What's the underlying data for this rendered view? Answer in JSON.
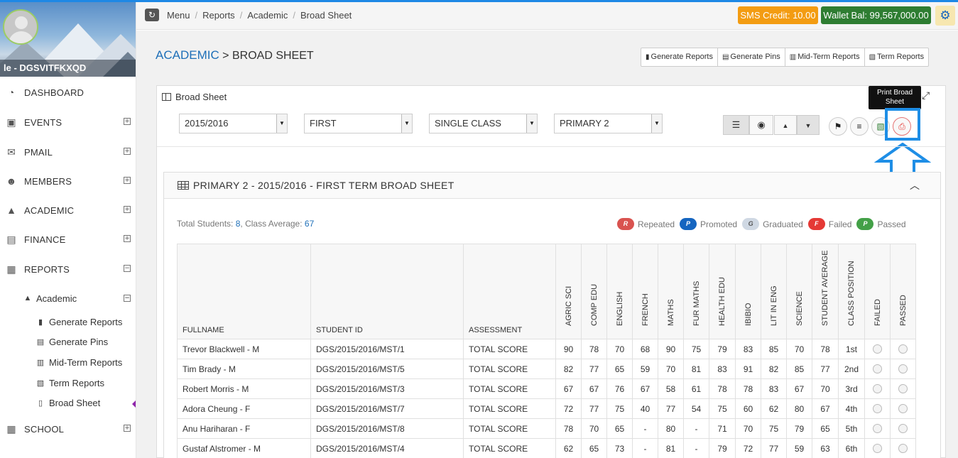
{
  "profile": {
    "name": "le - DGSVITFKXQD"
  },
  "sidebar": {
    "items": [
      {
        "label": "DASHBOARD",
        "icon": "dashboard-icon",
        "toggle": ""
      },
      {
        "label": "EVENTS",
        "icon": "calendar-icon",
        "toggle": "+"
      },
      {
        "label": "PMAIL",
        "icon": "mail-icon",
        "toggle": "+"
      },
      {
        "label": "MEMBERS",
        "icon": "members-icon",
        "toggle": "+"
      },
      {
        "label": "ACADEMIC",
        "icon": "graduation-cap-icon",
        "toggle": "+"
      },
      {
        "label": "FINANCE",
        "icon": "money-icon",
        "toggle": "+"
      },
      {
        "label": "REPORTS",
        "icon": "clipboard-icon",
        "toggle": "−"
      },
      {
        "label": "SCHOOL",
        "icon": "building-icon",
        "toggle": "+"
      }
    ],
    "academic_group": {
      "label": "Academic",
      "toggle": "−"
    },
    "sub_items": [
      {
        "label": "Generate Reports",
        "icon": "generate-reports-icon"
      },
      {
        "label": "Generate Pins",
        "icon": "generate-pins-icon"
      },
      {
        "label": "Mid-Term Reports",
        "icon": "mid-term-reports-icon"
      },
      {
        "label": "Term Reports",
        "icon": "term-reports-icon"
      },
      {
        "label": "Broad Sheet",
        "icon": "broad-sheet-icon"
      }
    ]
  },
  "topbar": {
    "breadcrumb": [
      "Menu",
      "Reports",
      "Academic",
      "Broad Sheet"
    ],
    "sms_credit": "SMS Credit: 10.00",
    "wallet_bal": "Wallet Bal: 99,567,000.00"
  },
  "page": {
    "title_accent": "ACADEMIC",
    "title_rest": " > BROAD SHEET",
    "report_buttons": [
      "Generate Reports",
      "Generate Pins",
      "Mid-Term Reports",
      "Term Reports"
    ]
  },
  "panel": {
    "title": "Broad Sheet",
    "tooltip": "Print Broad Sheet",
    "filters": {
      "session": "2015/2016",
      "term": "FIRST",
      "mode": "SINGLE CLASS",
      "class": "PRIMARY 2"
    }
  },
  "sheet": {
    "title": "PRIMARY 2 - 2015/2016 - FIRST TERM BROAD SHEET",
    "total_students_label": "Total Students: ",
    "total_students": "8",
    "class_average_label": ", Class Average: ",
    "class_average": "67",
    "legend": [
      {
        "letter": "R",
        "label": "Repeated",
        "color": "#d9534f"
      },
      {
        "letter": "P",
        "label": "Promoted",
        "color": "#1565c0"
      },
      {
        "letter": "G",
        "label": "Graduated",
        "color": "#cfd8e3"
      },
      {
        "letter": "F",
        "label": "Failed",
        "color": "#e53935"
      },
      {
        "letter": "P",
        "label": "Passed",
        "color": "#43a047"
      }
    ],
    "columns": [
      "FULLNAME",
      "STUDENT ID",
      "ASSESSMENT",
      "AGRIC SCI",
      "COMP EDU",
      "ENGLISH",
      "FRENCH",
      "MATHS",
      "FUR MATHS",
      "HEALTH EDU",
      "IBIBIO",
      "LIT IN ENG",
      "SCIENCE",
      "STUDENT AVERAGE",
      "CLASS POSITION",
      "FAILED",
      "PASSED"
    ],
    "rows": [
      {
        "name": "Trevor  Blackwell - M",
        "id": "DGS/2015/2016/MST/1",
        "assessment": "TOTAL SCORE",
        "scores": [
          "90",
          "78",
          "70",
          "68",
          "90",
          "75",
          "79",
          "83",
          "85",
          "70",
          "78",
          "1st"
        ]
      },
      {
        "name": "Tim  Brady - M",
        "id": "DGS/2015/2016/MST/5",
        "assessment": "TOTAL SCORE",
        "scores": [
          "82",
          "77",
          "65",
          "59",
          "70",
          "81",
          "83",
          "91",
          "82",
          "85",
          "77",
          "2nd"
        ]
      },
      {
        "name": "Robert  Morris - M",
        "id": "DGS/2015/2016/MST/3",
        "assessment": "TOTAL SCORE",
        "scores": [
          "67",
          "67",
          "76",
          "67",
          "58",
          "61",
          "78",
          "78",
          "83",
          "67",
          "70",
          "3rd"
        ]
      },
      {
        "name": "Adora  Cheung - F",
        "id": "DGS/2015/2016/MST/7",
        "assessment": "TOTAL SCORE",
        "scores": [
          "72",
          "77",
          "75",
          "40",
          "77",
          "54",
          "75",
          "60",
          "62",
          "80",
          "67",
          "4th"
        ]
      },
      {
        "name": "Anu  Hariharan - F",
        "id": "DGS/2015/2016/MST/8",
        "assessment": "TOTAL SCORE",
        "scores": [
          "78",
          "70",
          "65",
          "-",
          "80",
          "-",
          "71",
          "70",
          "75",
          "79",
          "65",
          "5th"
        ]
      },
      {
        "name": "Gustaf  Alstromer - M",
        "id": "DGS/2015/2016/MST/4",
        "assessment": "TOTAL SCORE",
        "scores": [
          "62",
          "65",
          "73",
          "-",
          "81",
          "-",
          "79",
          "72",
          "77",
          "59",
          "63",
          "6th"
        ]
      }
    ]
  }
}
